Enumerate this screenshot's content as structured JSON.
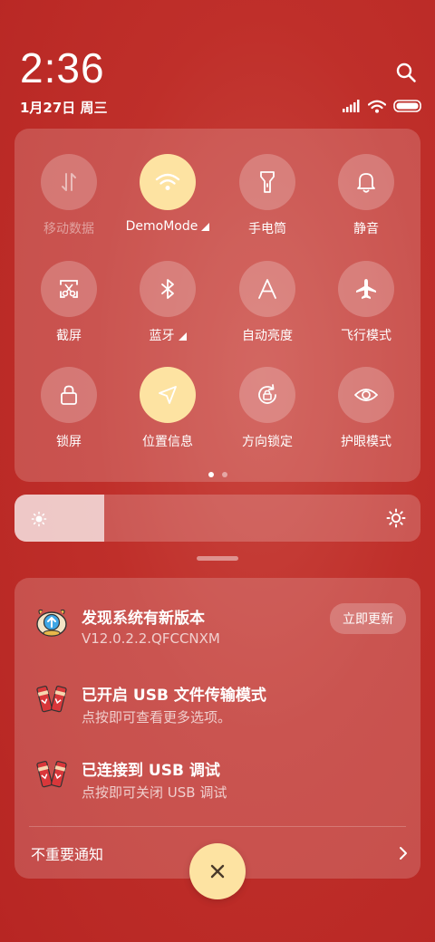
{
  "header": {
    "time": "2:36",
    "date": "1月27日 周三"
  },
  "colors": {
    "background": "#bf2f2a",
    "accent_on": "#fde3a2",
    "close_x": "#4a3a2a"
  },
  "quick_settings": {
    "tiles": [
      {
        "label": "移动数据",
        "icon": "mobile-data-icon",
        "active": false,
        "disabled": true
      },
      {
        "label": "DemoMode",
        "icon": "wifi-icon",
        "active": true,
        "disabled": false,
        "expandable": true
      },
      {
        "label": "手电筒",
        "icon": "flashlight-icon",
        "active": false,
        "disabled": false
      },
      {
        "label": "静音",
        "icon": "bell-icon",
        "active": false,
        "disabled": false
      },
      {
        "label": "截屏",
        "icon": "screenshot-icon",
        "active": false,
        "disabled": false
      },
      {
        "label": "蓝牙",
        "icon": "bluetooth-icon",
        "active": false,
        "disabled": false,
        "expandable": true
      },
      {
        "label": "自动亮度",
        "icon": "auto-brightness-icon",
        "active": false,
        "disabled": false
      },
      {
        "label": "飞行模式",
        "icon": "airplane-icon",
        "active": false,
        "disabled": false
      },
      {
        "label": "锁屏",
        "icon": "lock-icon",
        "active": false,
        "disabled": false
      },
      {
        "label": "位置信息",
        "icon": "location-icon",
        "active": true,
        "disabled": false
      },
      {
        "label": "方向锁定",
        "icon": "rotation-lock-icon",
        "active": false,
        "disabled": false
      },
      {
        "label": "护眼模式",
        "icon": "eye-icon",
        "active": false,
        "disabled": false
      }
    ],
    "pages": 2,
    "current_page": 1
  },
  "brightness": {
    "level": 0.22
  },
  "notifications": {
    "items": [
      {
        "title": "发现系统有新版本",
        "subtitle": "V12.0.2.2.QFCCNXM",
        "action": "立即更新",
        "icon": "update-icon"
      },
      {
        "title": "已开启 USB 文件传输模式",
        "subtitle": "点按即可查看更多选项。",
        "icon": "usb-icon"
      },
      {
        "title": "已连接到 USB 调试",
        "subtitle": "点按即可关闭 USB 调试",
        "icon": "usb-icon"
      }
    ],
    "unimportant_label": "不重要通知"
  }
}
